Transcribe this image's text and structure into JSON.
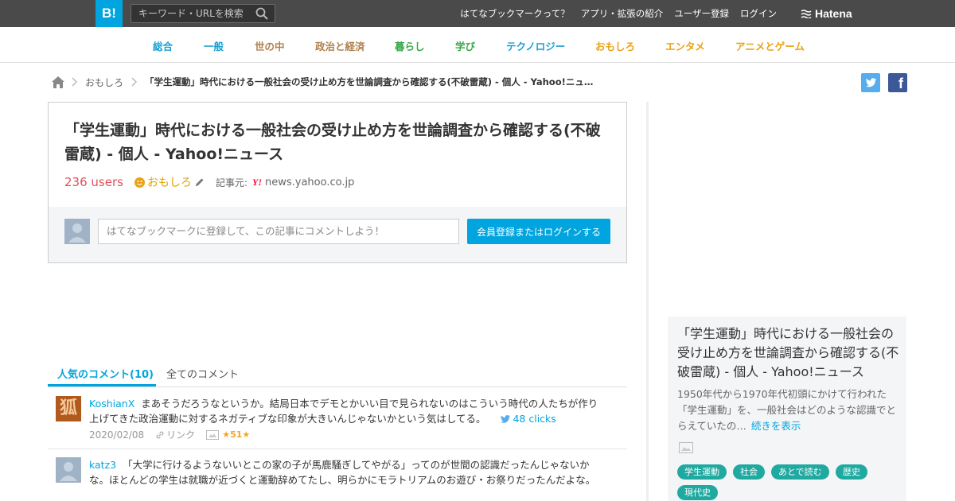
{
  "header": {
    "logo": "B!",
    "search_placeholder": "キーワード・URLを検索",
    "nav": [
      "はてなブックマークって？",
      "アプリ・拡張の紹介",
      "ユーザー登録",
      "ログイン"
    ],
    "brand": "Hatena"
  },
  "categories": [
    {
      "label": "総合",
      "color": "#1a9fcf"
    },
    {
      "label": "一般",
      "color": "#1a9fcf"
    },
    {
      "label": "世の中",
      "color": "#b07f4b"
    },
    {
      "label": "政治と経済",
      "color": "#b07f4b"
    },
    {
      "label": "暮らし",
      "color": "#3aa74a"
    },
    {
      "label": "学び",
      "color": "#3aa74a"
    },
    {
      "label": "テクノロジー",
      "color": "#1a9fcf"
    },
    {
      "label": "おもしろ",
      "color": "#e8a317"
    },
    {
      "label": "エンタメ",
      "color": "#e8a317"
    },
    {
      "label": "アニメとゲーム",
      "color": "#e8a317"
    }
  ],
  "breadcrumb": {
    "category": "おもしろ",
    "current": "「学生運動」時代における一般社会の受け止め方を世論調査から確認する(不破雷蔵) - 個人 - Yahoo!ニュ…"
  },
  "entry": {
    "title": "「学生運動」時代における一般社会の受け止め方を世論調査から確認する(不破雷蔵) - 個人 - Yahoo!ニュース",
    "users": "236 users",
    "category": "おもしろ",
    "source_label": "記事元:",
    "source_logo": "Y!",
    "domain": "news.yahoo.co.jp",
    "comment_placeholder": "はてなブックマークに登録して、この記事にコメントしよう！",
    "login_button": "会員登録またはログインする"
  },
  "tabs": {
    "popular": "人気のコメント(10)",
    "all": "全てのコメント"
  },
  "comments": [
    {
      "user": "KoshianX",
      "avatar_char": "狐",
      "text": "まあそうだろうなというか。結局日本でデモとかいい目で見られないのはこういう時代の人たちが作り上げてきた政治運動に対するネガティブな印象が大きいんじゃないかという気はしてる。",
      "clicks": "48 clicks",
      "date": "2020/02/08",
      "link": "リンク",
      "stars": "51"
    },
    {
      "user": "katz3",
      "text": "「大学に行けるようないいとこの家の子が馬鹿騒ぎしてやがる」ってのが世間の認識だったんじゃないかな。ほとんどの学生は就職が近づくと運動辞めてたし、明らかにモラトリアムのお遊び・お祭りだったんだよな。"
    }
  ],
  "sidebar": {
    "title": "「学生運動」時代における一般社会の受け止め方を世論調査から確認する(不破雷蔵) - 個人 - Yahoo!ニュース",
    "desc": "1950年代から1970年代初頭にかけて行われた「学生運動」を、一般社会はどのような認識でとらえていたの…",
    "more": "続きを表示",
    "tags": [
      "学生運動",
      "社会",
      "あとで読む",
      "歴史",
      "現代史"
    ]
  }
}
